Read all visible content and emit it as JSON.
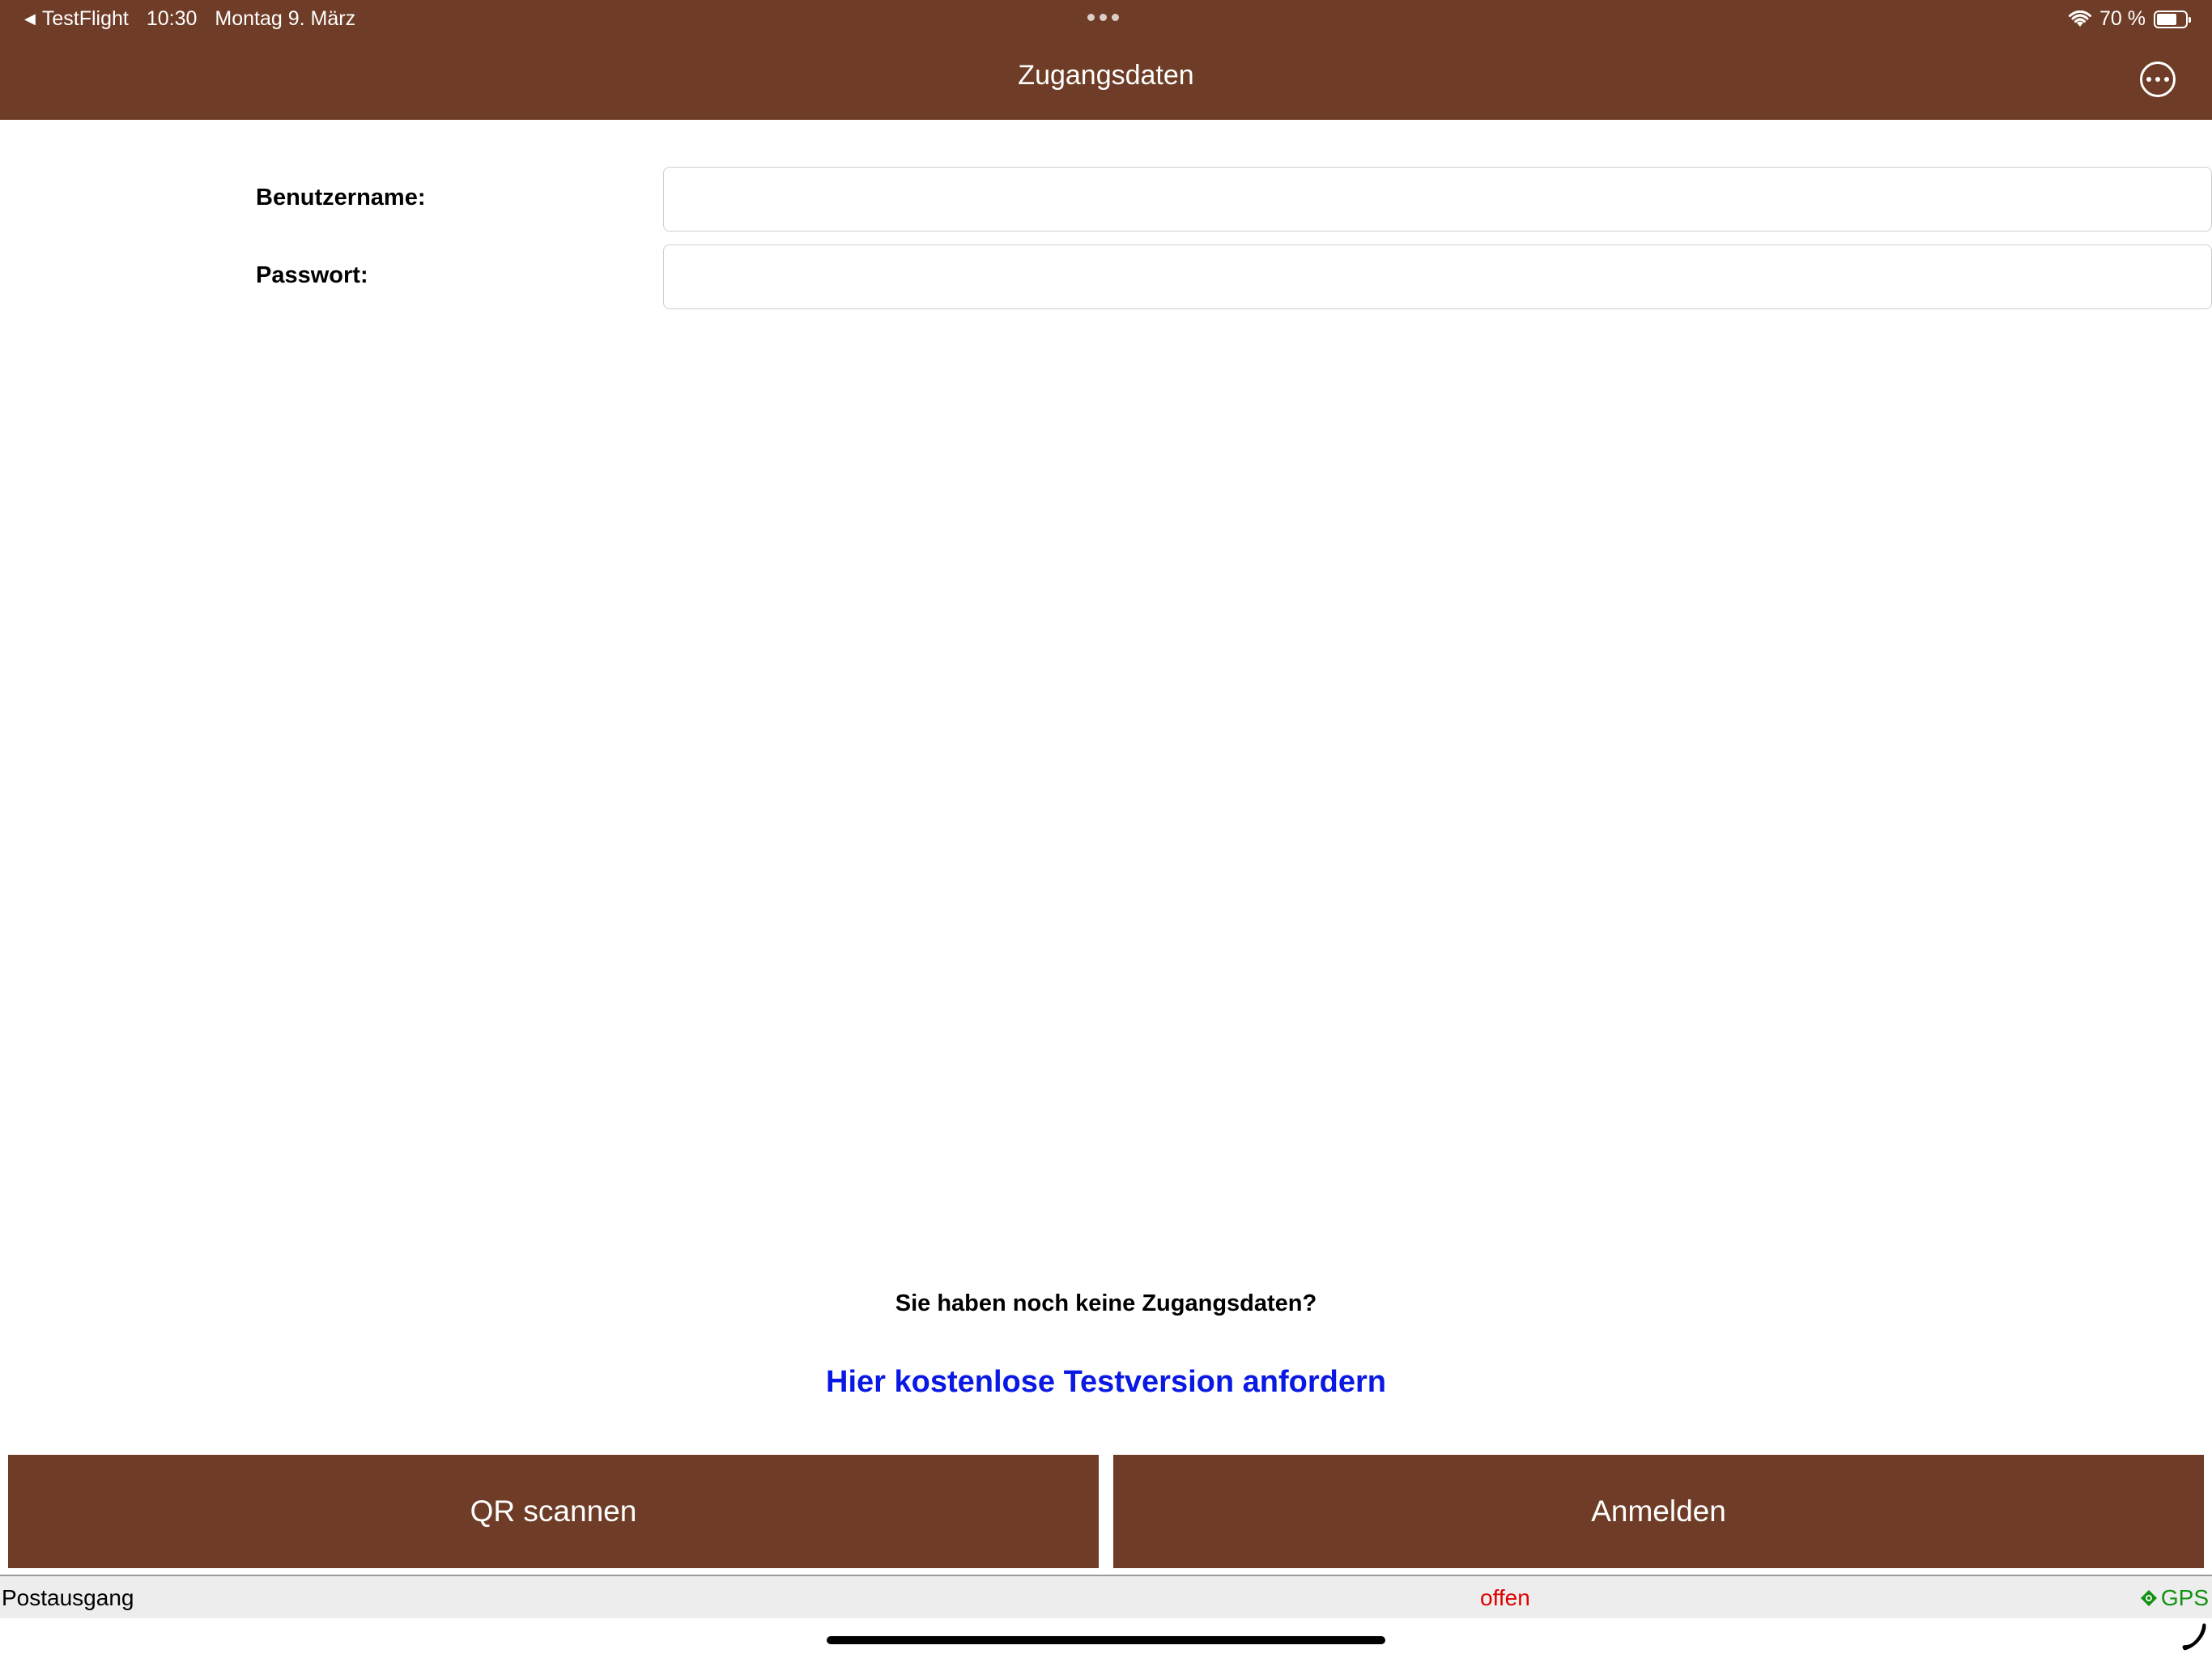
{
  "status_bar": {
    "back_app": "TestFlight",
    "time": "10:30",
    "date": "Montag 9. März",
    "battery": "70 %",
    "battery_level": 0.7
  },
  "header": {
    "title": "Zugangsdaten",
    "menu_icon": "ellipsis-circle-icon"
  },
  "form": {
    "username_label": "Benutzername:",
    "username_value": "",
    "password_label": "Passwort:",
    "password_value": ""
  },
  "signup": {
    "prompt": "Sie haben noch keine Zugangsdaten?",
    "link": "Hier kostenlose Testversion anfordern"
  },
  "buttons": {
    "qr_scan": "QR scannen",
    "login": "Anmelden"
  },
  "footer": {
    "outbox": "Postausgang",
    "status": "offen",
    "gps": "GPS"
  },
  "colors": {
    "brand": "#6f3d27",
    "link": "#0a18e4",
    "status_open": "#e00000",
    "gps": "#109210"
  }
}
